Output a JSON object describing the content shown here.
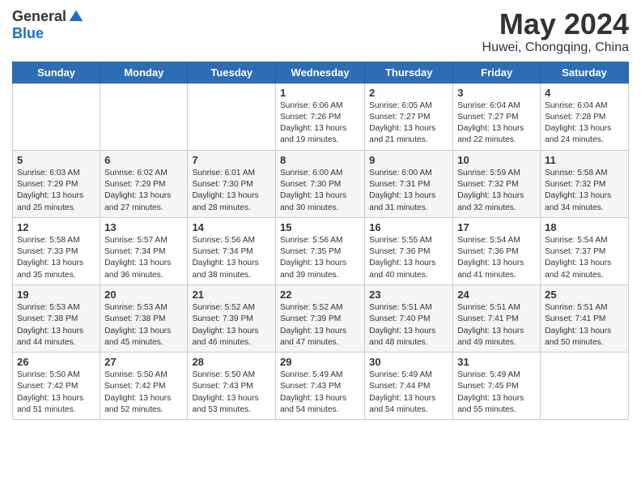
{
  "logo": {
    "general": "General",
    "blue": "Blue"
  },
  "title": {
    "month": "May 2024",
    "location": "Huwei, Chongqing, China"
  },
  "weekdays": [
    "Sunday",
    "Monday",
    "Tuesday",
    "Wednesday",
    "Thursday",
    "Friday",
    "Saturday"
  ],
  "weeks": [
    [
      {
        "day": "",
        "info": ""
      },
      {
        "day": "",
        "info": ""
      },
      {
        "day": "",
        "info": ""
      },
      {
        "day": "1",
        "info": "Sunrise: 6:06 AM\nSunset: 7:26 PM\nDaylight: 13 hours and 19 minutes."
      },
      {
        "day": "2",
        "info": "Sunrise: 6:05 AM\nSunset: 7:27 PM\nDaylight: 13 hours and 21 minutes."
      },
      {
        "day": "3",
        "info": "Sunrise: 6:04 AM\nSunset: 7:27 PM\nDaylight: 13 hours and 22 minutes."
      },
      {
        "day": "4",
        "info": "Sunrise: 6:04 AM\nSunset: 7:28 PM\nDaylight: 13 hours and 24 minutes."
      }
    ],
    [
      {
        "day": "5",
        "info": "Sunrise: 6:03 AM\nSunset: 7:29 PM\nDaylight: 13 hours and 25 minutes."
      },
      {
        "day": "6",
        "info": "Sunrise: 6:02 AM\nSunset: 7:29 PM\nDaylight: 13 hours and 27 minutes."
      },
      {
        "day": "7",
        "info": "Sunrise: 6:01 AM\nSunset: 7:30 PM\nDaylight: 13 hours and 28 minutes."
      },
      {
        "day": "8",
        "info": "Sunrise: 6:00 AM\nSunset: 7:30 PM\nDaylight: 13 hours and 30 minutes."
      },
      {
        "day": "9",
        "info": "Sunrise: 6:00 AM\nSunset: 7:31 PM\nDaylight: 13 hours and 31 minutes."
      },
      {
        "day": "10",
        "info": "Sunrise: 5:59 AM\nSunset: 7:32 PM\nDaylight: 13 hours and 32 minutes."
      },
      {
        "day": "11",
        "info": "Sunrise: 5:58 AM\nSunset: 7:32 PM\nDaylight: 13 hours and 34 minutes."
      }
    ],
    [
      {
        "day": "12",
        "info": "Sunrise: 5:58 AM\nSunset: 7:33 PM\nDaylight: 13 hours and 35 minutes."
      },
      {
        "day": "13",
        "info": "Sunrise: 5:57 AM\nSunset: 7:34 PM\nDaylight: 13 hours and 36 minutes."
      },
      {
        "day": "14",
        "info": "Sunrise: 5:56 AM\nSunset: 7:34 PM\nDaylight: 13 hours and 38 minutes."
      },
      {
        "day": "15",
        "info": "Sunrise: 5:56 AM\nSunset: 7:35 PM\nDaylight: 13 hours and 39 minutes."
      },
      {
        "day": "16",
        "info": "Sunrise: 5:55 AM\nSunset: 7:36 PM\nDaylight: 13 hours and 40 minutes."
      },
      {
        "day": "17",
        "info": "Sunrise: 5:54 AM\nSunset: 7:36 PM\nDaylight: 13 hours and 41 minutes."
      },
      {
        "day": "18",
        "info": "Sunrise: 5:54 AM\nSunset: 7:37 PM\nDaylight: 13 hours and 42 minutes."
      }
    ],
    [
      {
        "day": "19",
        "info": "Sunrise: 5:53 AM\nSunset: 7:38 PM\nDaylight: 13 hours and 44 minutes."
      },
      {
        "day": "20",
        "info": "Sunrise: 5:53 AM\nSunset: 7:38 PM\nDaylight: 13 hours and 45 minutes."
      },
      {
        "day": "21",
        "info": "Sunrise: 5:52 AM\nSunset: 7:39 PM\nDaylight: 13 hours and 46 minutes."
      },
      {
        "day": "22",
        "info": "Sunrise: 5:52 AM\nSunset: 7:39 PM\nDaylight: 13 hours and 47 minutes."
      },
      {
        "day": "23",
        "info": "Sunrise: 5:51 AM\nSunset: 7:40 PM\nDaylight: 13 hours and 48 minutes."
      },
      {
        "day": "24",
        "info": "Sunrise: 5:51 AM\nSunset: 7:41 PM\nDaylight: 13 hours and 49 minutes."
      },
      {
        "day": "25",
        "info": "Sunrise: 5:51 AM\nSunset: 7:41 PM\nDaylight: 13 hours and 50 minutes."
      }
    ],
    [
      {
        "day": "26",
        "info": "Sunrise: 5:50 AM\nSunset: 7:42 PM\nDaylight: 13 hours and 51 minutes."
      },
      {
        "day": "27",
        "info": "Sunrise: 5:50 AM\nSunset: 7:42 PM\nDaylight: 13 hours and 52 minutes."
      },
      {
        "day": "28",
        "info": "Sunrise: 5:50 AM\nSunset: 7:43 PM\nDaylight: 13 hours and 53 minutes."
      },
      {
        "day": "29",
        "info": "Sunrise: 5:49 AM\nSunset: 7:43 PM\nDaylight: 13 hours and 54 minutes."
      },
      {
        "day": "30",
        "info": "Sunrise: 5:49 AM\nSunset: 7:44 PM\nDaylight: 13 hours and 54 minutes."
      },
      {
        "day": "31",
        "info": "Sunrise: 5:49 AM\nSunset: 7:45 PM\nDaylight: 13 hours and 55 minutes."
      },
      {
        "day": "",
        "info": ""
      }
    ]
  ]
}
